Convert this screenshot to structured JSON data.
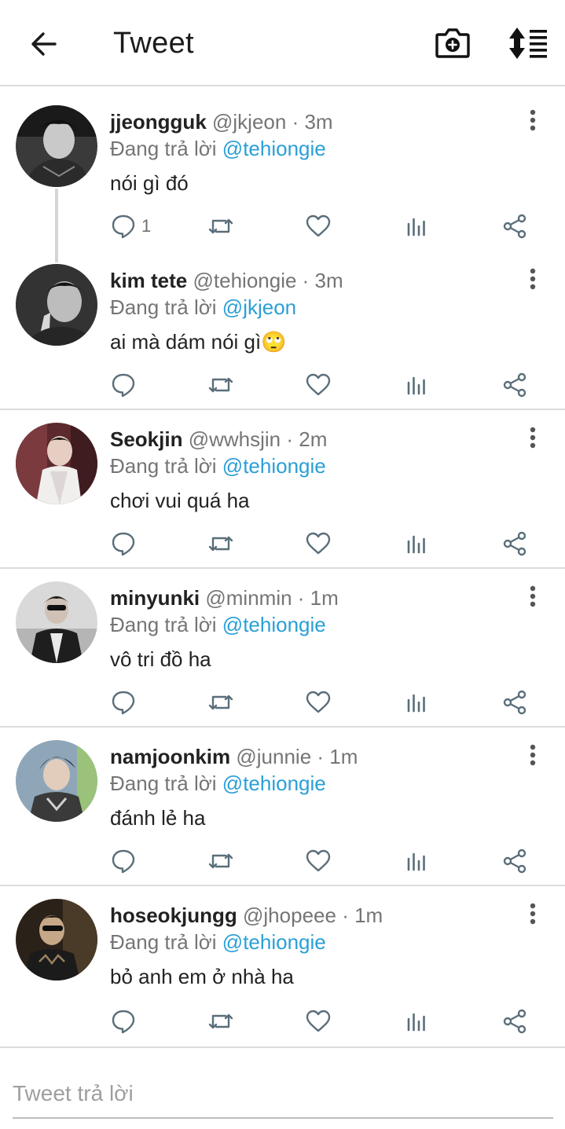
{
  "header": {
    "title": "Tweet",
    "back_icon": "arrow-left-icon",
    "camera_icon": "camera-plus-icon",
    "sort_icon": "sort-list-icon"
  },
  "colors": {
    "mention": "#2a9fd6",
    "divider": "#dcdcdc",
    "muted": "#757575",
    "text": "#222222"
  },
  "tweets": [
    {
      "name": "jjeongguk",
      "handle": "@jkjeon",
      "time": "· 3m",
      "reply_prefix": "Đang trả lời",
      "reply_to": "@tehiongie",
      "text": "nói gì đó",
      "reply_count": "1"
    },
    {
      "name": "kim tete",
      "handle": "@tehiongie",
      "time": "· 3m",
      "reply_prefix": "Đang trả lời",
      "reply_to": "@jkjeon",
      "text": "ai mà dám nói gì🙄",
      "reply_count": ""
    },
    {
      "name": "Seokjin",
      "handle": "@wwhsjin",
      "time": "· 2m",
      "reply_prefix": "Đang trả lời",
      "reply_to": "@tehiongie",
      "text": "chơi vui quá ha",
      "reply_count": ""
    },
    {
      "name": "minyunki",
      "handle": "@minmin",
      "time": "· 1m",
      "reply_prefix": "Đang trả lời",
      "reply_to": "@tehiongie",
      "text": "vô tri đồ ha",
      "reply_count": ""
    },
    {
      "name": "namjoonkim",
      "handle": "@junnie",
      "time": "· 1m",
      "reply_prefix": "Đang trả lời",
      "reply_to": "@tehiongie",
      "text": "đánh lẻ ha",
      "reply_count": ""
    },
    {
      "name": "hoseokjungg",
      "handle": "@jhopeee",
      "time": "· 1m",
      "reply_prefix": "Đang trả lời",
      "reply_to": "@tehiongie",
      "text": "bỏ anh em ở nhà ha",
      "reply_count": ""
    }
  ],
  "action_icons": [
    "reply-icon",
    "retweet-icon",
    "like-icon",
    "analytics-icon",
    "share-icon"
  ],
  "composer": {
    "placeholder": "Tweet trả lời"
  }
}
